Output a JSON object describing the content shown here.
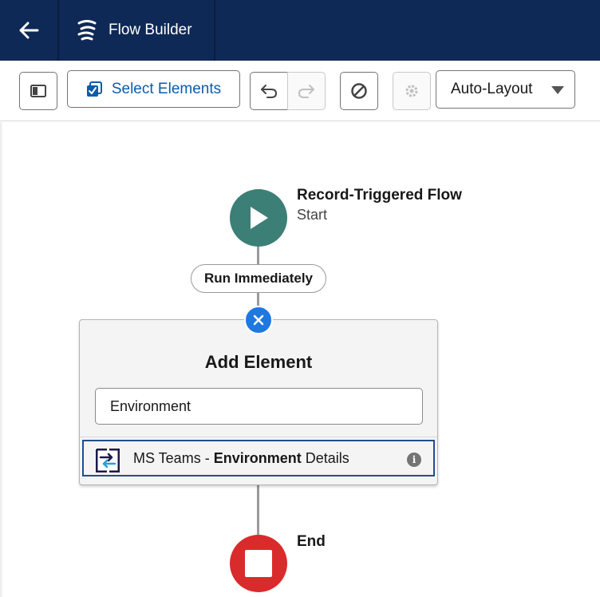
{
  "header": {
    "title": "Flow Builder",
    "back_icon": "arrow-left-icon",
    "logo_icon": "flow-logo-icon",
    "background_color": "#0f2956"
  },
  "toolbar": {
    "toggle_panel_icon": "panel-toggle-icon",
    "select_elements_label": "Select Elements",
    "undo_icon": "undo-icon",
    "redo_icon": "redo-icon",
    "debug_icon": "prohibit-icon",
    "settings_icon": "gear-icon",
    "layout_selected": "Auto-Layout",
    "accent_color": "#0b5cab"
  },
  "canvas": {
    "start": {
      "title": "Record-Triggered Flow",
      "subtitle": "Start",
      "color": "#3b7f76"
    },
    "path_label": "Run Immediately",
    "add_element": {
      "title": "Add Element",
      "search_value": "Environment",
      "close_color": "#1f78e0",
      "result": {
        "prefix": "MS Teams - ",
        "highlight": "Environment",
        "suffix": " Details",
        "info_icon": "info-icon"
      }
    },
    "end": {
      "label": "End",
      "color": "#d92b2b"
    }
  }
}
